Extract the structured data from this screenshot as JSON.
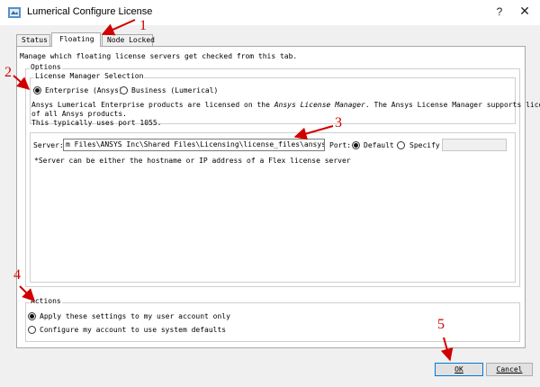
{
  "window": {
    "title": "Lumerical Configure License",
    "help_glyph": "?",
    "close_glyph": "✕"
  },
  "tabs": [
    {
      "label": "Status"
    },
    {
      "label": "Floating"
    },
    {
      "label": "Node Locked"
    }
  ],
  "description": "Manage which floating license servers get checked from this tab.",
  "options": {
    "legend": "Options",
    "license_manager": {
      "legend": "License Manager Selection",
      "enterprise_label": "Enterprise (Ansys)",
      "business_label": "Business (Lumerical)"
    },
    "info_line1_pre": "Ansys Lumerical Enterprise products are licensed on the ",
    "info_line1_italic": "Ansys License Manager",
    "info_line1_post": ". The Ansys License Manager supports licensing",
    "info_line2": "of all Ansys products.",
    "info_line3": "This typically uses port 1055.",
    "server_label": "Server:",
    "server_value": "m Files\\ANSYS Inc\\Shared Files\\Licensing\\license_files\\ansyslmd.lic",
    "port_label": "Port:",
    "default_label": "Default",
    "specify_label": "Specify",
    "specify_value": "",
    "server_note": "*Server can be either the hostname or IP address of a Flex license server"
  },
  "actions": {
    "legend": "Actions",
    "apply_label": "Apply these settings to my user account only",
    "configure_label": "Configure my account to use system defaults"
  },
  "buttons": {
    "ok": "OK",
    "cancel": "Cancel"
  },
  "annotations": [
    "1",
    "2",
    "3",
    "4",
    "5"
  ],
  "colors": {
    "annotation": "#d00000",
    "ok_border": "#0078d7"
  }
}
